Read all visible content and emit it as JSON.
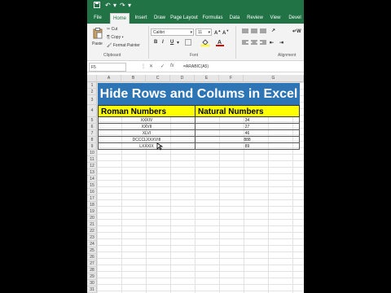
{
  "qat": {
    "save_icon": "save-icon",
    "undo_icon": "undo-icon",
    "redo_icon": "redo-icon",
    "more_icon": "more-icon"
  },
  "tabs": [
    "File",
    "Home",
    "Insert",
    "Draw",
    "Page Layout",
    "Formulas",
    "Data",
    "Review",
    "View",
    "Devel"
  ],
  "ribbon": {
    "paste_label": "Paste",
    "cut_label": "Cut",
    "copy_label": "Copy",
    "format_painter_label": "Format Painter",
    "clipboard_group": "Clipboard",
    "font_name": "Calibri",
    "font_size": "11",
    "font_group": "Font",
    "alignment_group": "Alignment",
    "bold": "B",
    "italic": "I",
    "underline": "U",
    "wrap": "W"
  },
  "formula_bar": {
    "name_box": "F5",
    "formula": "=ARABIC(A5)"
  },
  "columns": [
    "A",
    "B",
    "C",
    "D",
    "E",
    "F",
    "G"
  ],
  "rows": [
    "1",
    "2",
    "3",
    "4",
    "5",
    "6",
    "7",
    "8",
    "9",
    "10",
    "11",
    "12",
    "13",
    "14",
    "15",
    "16",
    "17",
    "18",
    "19",
    "20",
    "21",
    "22",
    "23",
    "24",
    "25",
    "26",
    "27",
    "28",
    "29",
    "30",
    "31"
  ],
  "sheet": {
    "banner_title": "Hide Rows and Colums in Excel",
    "header_left": "Roman Numbers",
    "header_right": "Natural Numbers",
    "table_rows": [
      {
        "roman": "XXXIV",
        "natural": "34"
      },
      {
        "roman": "XXVII",
        "natural": "27"
      },
      {
        "roman": "XLVI",
        "natural": "46"
      },
      {
        "roman": "DCCCLXXXVIII",
        "natural": "888"
      },
      {
        "roman": "LXXXIX",
        "natural": "89"
      }
    ]
  },
  "colors": {
    "excel_green": "#217346",
    "banner_blue": "#2e75b6",
    "header_yellow": "#ffff00"
  }
}
